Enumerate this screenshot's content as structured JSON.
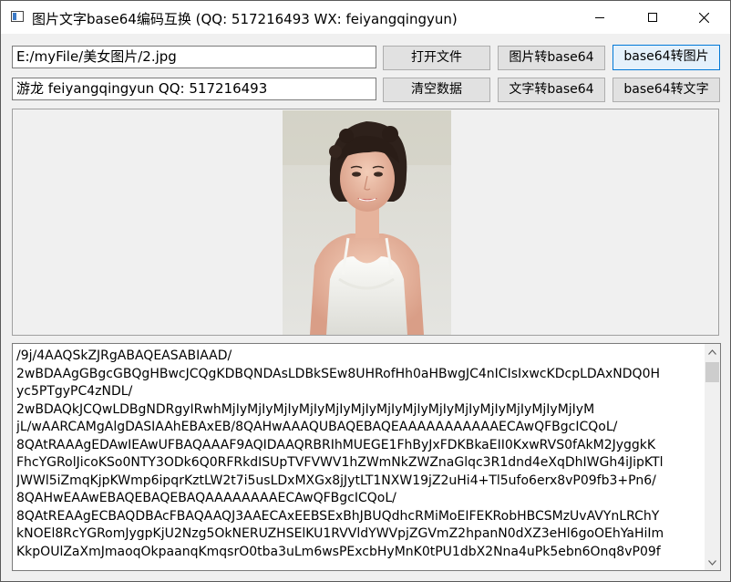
{
  "window": {
    "title": "图片文字base64编码互换 (QQ: 517216493 WX: feiyangqingyun)"
  },
  "inputs": {
    "file_path": "E:/myFile/美女图片/2.jpg",
    "text_value": "游龙 feiyangqingyun QQ: 517216493"
  },
  "buttons": {
    "open_file": "打开文件",
    "image_to_base64": "图片转base64",
    "base64_to_image": "base64转图片",
    "clear_data": "清空数据",
    "text_to_base64": "文字转base64",
    "base64_to_text": "base64转文字"
  },
  "output": {
    "lines": [
      "/9j/4AAQSkZJRgABAQEASABIAAD/",
      "2wBDAAgGBgcGBQgHBwcJCQgKDBQNDAsLDBkSEw8UHRofHh0aHBwgJC4nICIsIxwcKDcpLDAxNDQ0H",
      "yc5PTgyPC4zNDL/",
      "2wBDAQkJCQwLDBgNDRgyIRwhMjIyMjIyMjIyMjIyMjIyMjIyMjIyMjIyMjIyMjIyMjIyMjIyMjIyMjIyM",
      "jL/wAARCAMgAlgDASIAAhEBAxEB/8QAHwAAAQUBAQEBAQEAAAAAAAAAAAECAwQFBgcICQoL/",
      "8QAtRAAAgEDAwIEAwUFBAQAAAF9AQIDAAQRBRIhMUEGE1FhByJxFDKBkaEII0KxwRVS0fAkM2JyggkK",
      "FhcYGRolJicoKSo0NTY3ODk6Q0RFRkdISUpTVFVWV1hZWmNkZWZnaGlqc3R1dnd4eXqDhIWGh4iJipKTl",
      "JWWl5iZmqKjpKWmp6ipqrKztLW2t7i5usLDxMXGx8jJytLT1NXW19jZ2uHi4+Tl5ufo6erx8vP09fb3+Pn6/",
      "8QAHwEAAwEBAQEBAQEBAQAAAAAAAAECAwQFBgcICQoL/",
      "8QAtREAAgECBAQDBAcFBAQAAQJ3AAECAxEEBSExBhJBUQdhcRMiMoEIFEKRobHBCSMzUvAVYnLRChY",
      "kNOEl8RcYGRomJygpKjU2Nzg5OkNERUZHSElKU1RVVldYWVpjZGVmZ2hpanN0dXZ3eHl6goOEhYaHiIm",
      "KkpOUlZaXmJmaoqOkpaanqKmqsrO0tba3uLm6wsPExcbHyMnK0tPU1dbX2Nna4uPk5ebn6Onq8vP09f"
    ]
  }
}
